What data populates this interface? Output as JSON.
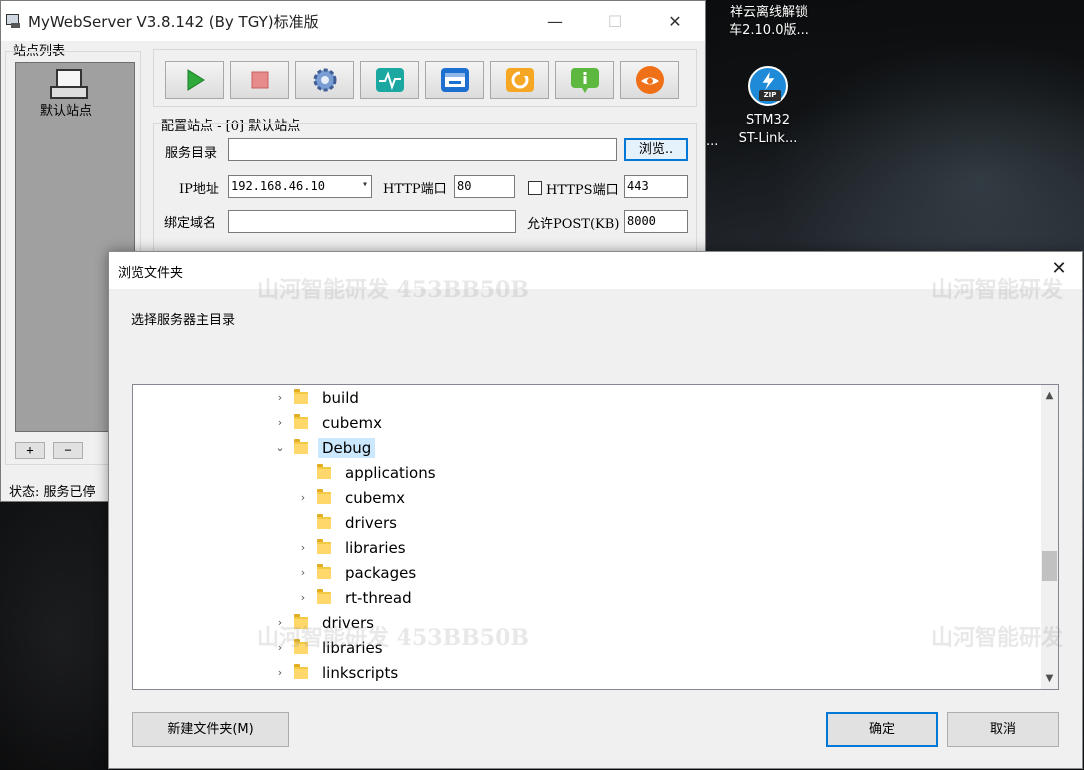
{
  "desktop": {
    "icon1_label": "祥云离线解锁\n车2.10.0版...",
    "icon2_label": "STM32\nST-Link...",
    "icon2_tag": "ZIP",
    "side_ellipsis": "..."
  },
  "main_window": {
    "title": "MyWebServer V3.8.142 (By TGY)标准版",
    "site_list_label": "站点列表",
    "site_item": "默认站点",
    "add_btn": "+",
    "remove_btn": "−",
    "toolbar": [
      {
        "name": "start",
        "color": "#2eaa3a"
      },
      {
        "name": "stop",
        "color": "#e05050"
      },
      {
        "name": "settings",
        "color": "#5a7fb8"
      },
      {
        "name": "monitor",
        "color": "#1aa8a0"
      },
      {
        "name": "window",
        "color": "#1d6fd0"
      },
      {
        "name": "refresh",
        "color": "#f0a020"
      },
      {
        "name": "info",
        "color": "#5db840"
      },
      {
        "name": "about",
        "color": "#f07018"
      }
    ],
    "config_label": "配置站点 - [0] 默认站点",
    "service_dir_label": "服务目录",
    "service_dir_value": "",
    "browse_btn": "浏览..",
    "ip_label": "IP地址",
    "ip_value": "192.168.46.10",
    "http_port_label": "HTTP端口",
    "http_port_value": "80",
    "https_label": "HTTPS端口",
    "https_value": "443",
    "domain_label": "绑定域名",
    "domain_value": "",
    "post_label": "允许POST(KB)",
    "post_value": "8000",
    "status_label": "状态: 服务已停"
  },
  "dialog": {
    "title": "浏览文件夹",
    "close": "✕",
    "prompt": "选择服务器主目录",
    "watermark": "山河智能研发 453BB50B",
    "watermark_right": "山河智能研发",
    "tree": [
      {
        "label": "build",
        "indent": 0,
        "expander": "›",
        "selected": false
      },
      {
        "label": "cubemx",
        "indent": 0,
        "expander": "›",
        "selected": false
      },
      {
        "label": "Debug",
        "indent": 0,
        "expander": "⌄",
        "selected": true
      },
      {
        "label": "applications",
        "indent": 1,
        "expander": "",
        "selected": false
      },
      {
        "label": "cubemx",
        "indent": 1,
        "expander": "›",
        "selected": false
      },
      {
        "label": "drivers",
        "indent": 1,
        "expander": "",
        "selected": false
      },
      {
        "label": "libraries",
        "indent": 1,
        "expander": "›",
        "selected": false
      },
      {
        "label": "packages",
        "indent": 1,
        "expander": "›",
        "selected": false
      },
      {
        "label": "rt-thread",
        "indent": 1,
        "expander": "›",
        "selected": false
      },
      {
        "label": "drivers",
        "indent": 0,
        "expander": "›",
        "selected": false
      },
      {
        "label": "libraries",
        "indent": 0,
        "expander": "›",
        "selected": false
      },
      {
        "label": "linkscripts",
        "indent": 0,
        "expander": "›",
        "selected": false
      }
    ],
    "new_folder_btn": "新建文件夹(M)",
    "ok_btn": "确定",
    "cancel_btn": "取消"
  }
}
